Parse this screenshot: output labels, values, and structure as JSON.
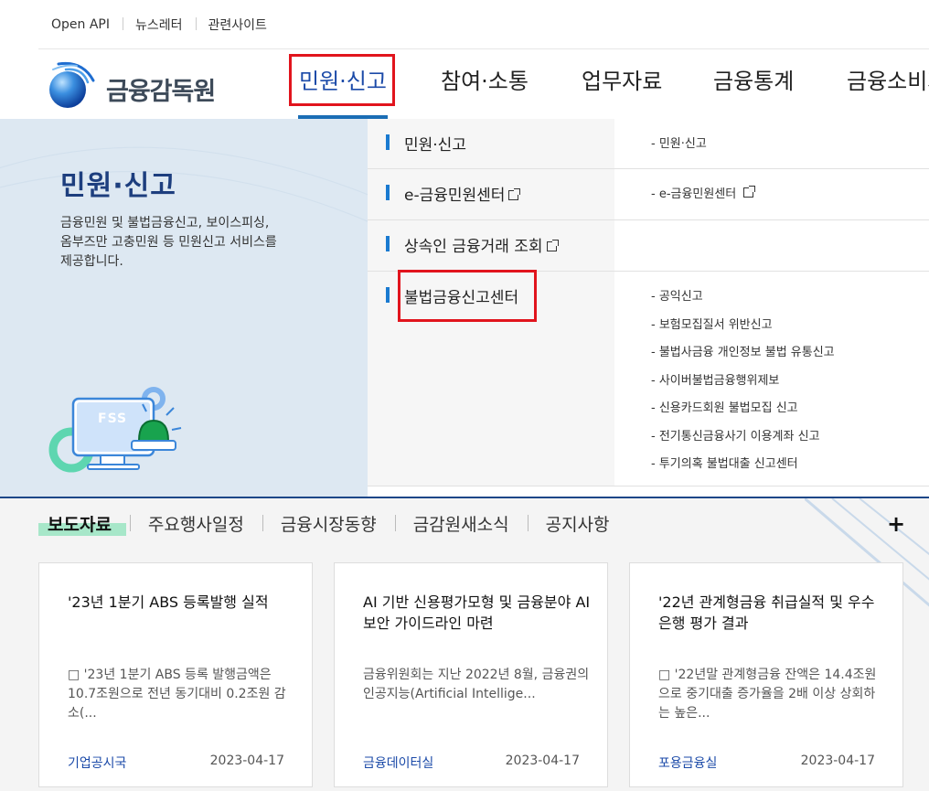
{
  "utility_nav": [
    "Open API",
    "뉴스레터",
    "관련사이트"
  ],
  "logo": {
    "text": "금융감독원"
  },
  "gnb": [
    {
      "label": "민원·신고"
    },
    {
      "label": "참여·소통"
    },
    {
      "label": "업무자료"
    },
    {
      "label": "금융통계"
    },
    {
      "label": "금융소비자"
    }
  ],
  "mega": {
    "title": "민원·신고",
    "description": "금융민원 및 불법금융신고, 보이스피싱, 옴부즈만 고충민원 등 민원신고 서비스를 제공합니다.",
    "illustration_label": "FSS",
    "categories": [
      {
        "label": "민원·신고",
        "items": [
          "- 민원·신고"
        ]
      },
      {
        "label": "e-금융민원센터",
        "items": [
          "- e-금융민원센터"
        ]
      },
      {
        "label": "상속인 금융거래 조회",
        "items": []
      },
      {
        "label": "불법금융신고센터",
        "items": [
          "- 공익신고",
          "- 보험모집질서 위반신고",
          "- 불법사금융 개인정보 불법 유통신고",
          "- 사이버불법금융행위제보",
          "- 신용카드회원 불법모집 신고",
          "- 전기통신금융사기 이용계좌 신고",
          "- 투기의혹 불법대출 신고센터"
        ]
      }
    ]
  },
  "news_tabs": [
    "보도자료",
    "주요행사일정",
    "금융시장동향",
    "금감원새소식",
    "공지사항"
  ],
  "more_label": "+",
  "cards": [
    {
      "title": "'23년 1분기 ABS 등록발행 실적",
      "desc": "□ '23년 1분기 ABS 등록 발행금액은 10.7조원으로 전년 동기대비 0.2조원 감소(...",
      "dept": "기업공시국",
      "date": "2023-04-17"
    },
    {
      "title": "AI 기반 신용평가모형 및 금융분야 AI 보안 가이드라인 마련",
      "desc": "금융위원회는 지난 2022년 8월, 금융권의 인공지능(Artificial Intellige...",
      "dept": "금융데이터실",
      "date": "2023-04-17"
    },
    {
      "title": "'22년 관계형금융 취급실적 및 우수은행 평가 결과",
      "desc": "□ '22년말 관계형금융 잔액은 14.4조원으로 중기대출 증가율을 2배 이상 상회하는 높은...",
      "dept": "포용금융실",
      "date": "2023-04-17"
    }
  ],
  "colors": {
    "accent": "#1a6db5",
    "highlight": "#e1141d",
    "tab_marker": "#a7e7c9",
    "left_panel": "#dde8f2"
  }
}
